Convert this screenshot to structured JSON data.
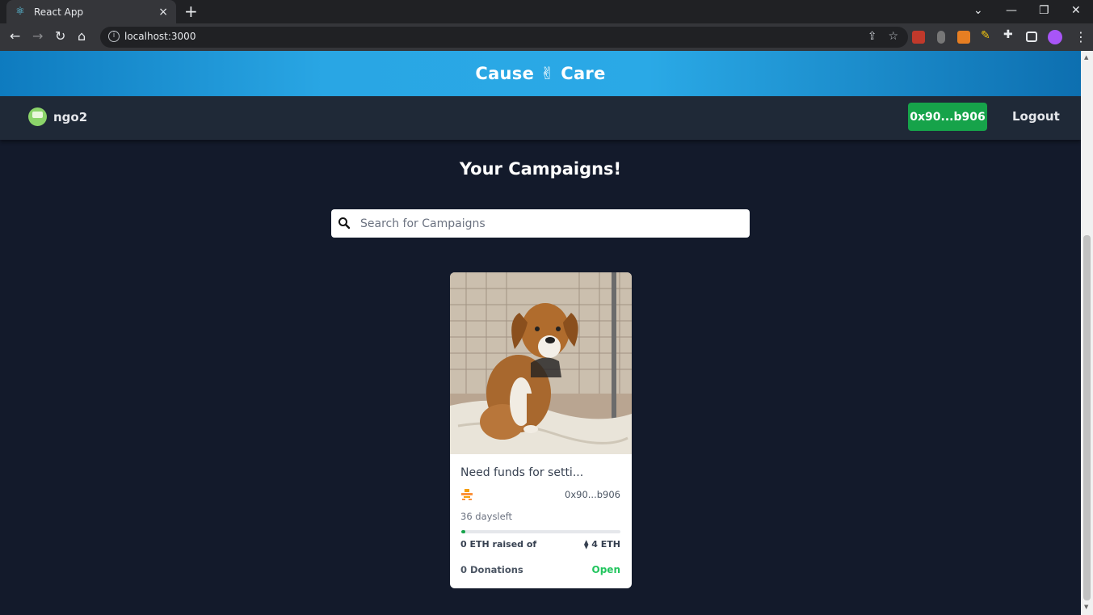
{
  "browser": {
    "tab_title": "React App",
    "tab_close_icon": "×",
    "new_tab_icon": "+",
    "url": "localhost:3000",
    "info_icon": "i"
  },
  "app": {
    "brand": "Cause ✌ Care",
    "username": "ngo2",
    "wallet_label": "0x90...b906",
    "logout_label": "Logout",
    "heading": "Your Campaigns!",
    "search_placeholder": "Search for Campaigns"
  },
  "campaign": {
    "title": "Need funds for setti...",
    "owner_address": "0x90...b906",
    "days_left": "36 daysleft",
    "raised_label": "0 ETH raised of",
    "target_label": "⧫ 4 ETH",
    "progress_fraction": 0.01,
    "donations_label": "0 Donations",
    "status": "Open"
  },
  "colors": {
    "accent_green": "#16a34a",
    "status_green": "#22c55e",
    "page_bg": "#131a2b",
    "navbar_bg": "#1f2937"
  }
}
